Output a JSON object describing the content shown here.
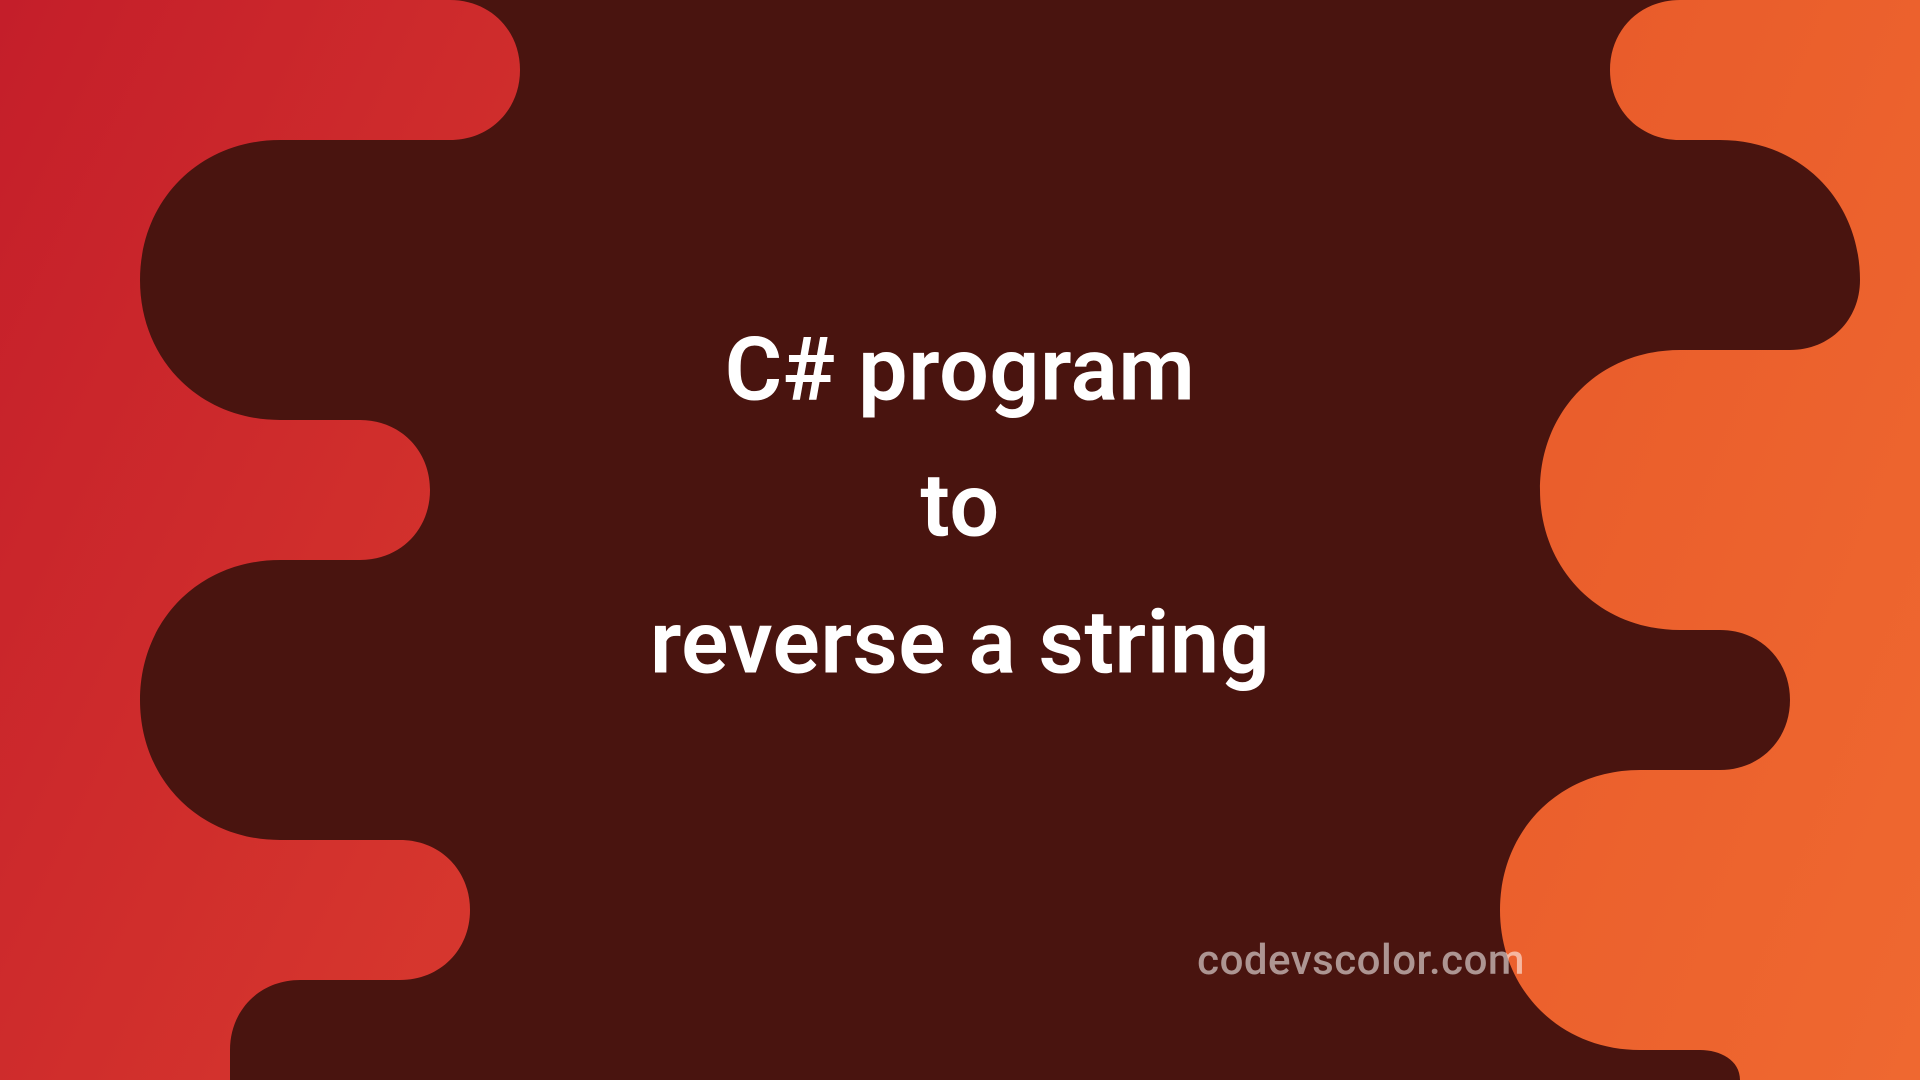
{
  "title": {
    "line1": "C# program",
    "line2": "to",
    "line3": "reverse a string"
  },
  "watermark": "codevscolor.com",
  "colors": {
    "background_center": "#49140f",
    "left_gradient_start": "#c41e2a",
    "left_gradient_end": "#d93a2e",
    "right_gradient_start": "#e85a2a",
    "right_gradient_end": "#ef6830",
    "text": "#ffffff",
    "watermark": "rgba(255,255,255,0.55)"
  }
}
